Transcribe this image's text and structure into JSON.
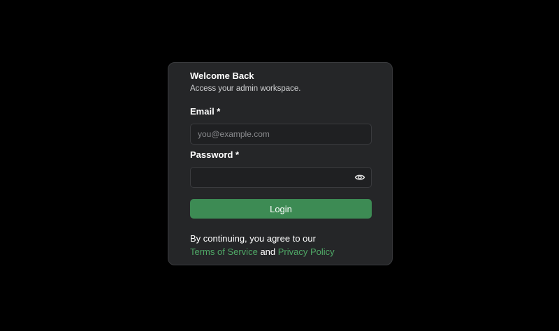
{
  "login": {
    "title": "Welcome Back",
    "subtitle": "Access your admin workspace.",
    "email_label": "Email *",
    "email_placeholder": "you@example.com",
    "email_value": "",
    "password_label": "Password *",
    "password_placeholder": "",
    "password_value": "",
    "password_toggle_icon": "eye-icon",
    "submit_label": "Login",
    "terms_prefix": "By continuing, you agree to our",
    "terms_link": "Terms of Service",
    "terms_and": "and",
    "privacy_link": "Privacy Policy"
  },
  "colors": {
    "background": "#000000",
    "card": "#252628",
    "accent": "#3d8b54",
    "link": "#4fa866"
  }
}
